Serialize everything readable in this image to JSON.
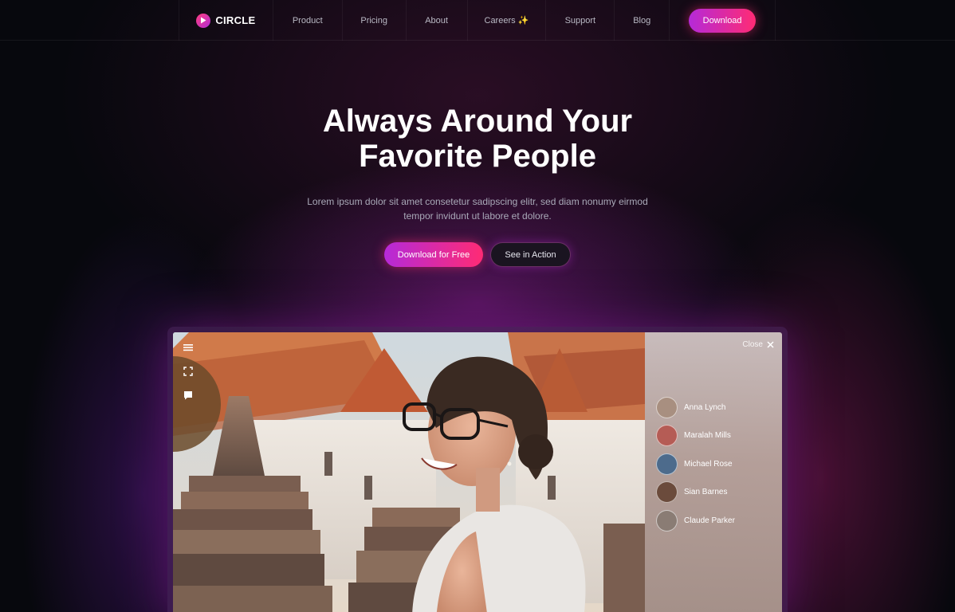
{
  "nav": {
    "brand": "CIRCLE",
    "items": [
      "Product",
      "Pricing",
      "About",
      "Careers ✨",
      "Support",
      "Blog"
    ],
    "download_label": "Download"
  },
  "hero": {
    "title_line1": "Always Around Your",
    "title_line2": "Favorite People",
    "subtitle_line1": "Lorem ipsum dolor sit amet consetetur sadipscing elitr, sed diam nonumy eirmod",
    "subtitle_line2": "tempor invidunt ut labore et dolore.",
    "primary_button": "Download for Free",
    "secondary_button": "See in Action"
  },
  "app": {
    "close_label": "Close",
    "participants": [
      {
        "name": "Anna Lynch",
        "avatar_color": "#a88f80"
      },
      {
        "name": "Maralah Mills",
        "avatar_color": "#b55c55"
      },
      {
        "name": "Michael Rose",
        "avatar_color": "#4d6b8c"
      },
      {
        "name": "Sian Barnes",
        "avatar_color": "#6b4b3c"
      },
      {
        "name": "Claude Parker",
        "avatar_color": "#8a7c74"
      }
    ]
  },
  "colors": {
    "accent_from": "#b52ad8",
    "accent_to": "#ff2b74",
    "background": "#07080d"
  }
}
